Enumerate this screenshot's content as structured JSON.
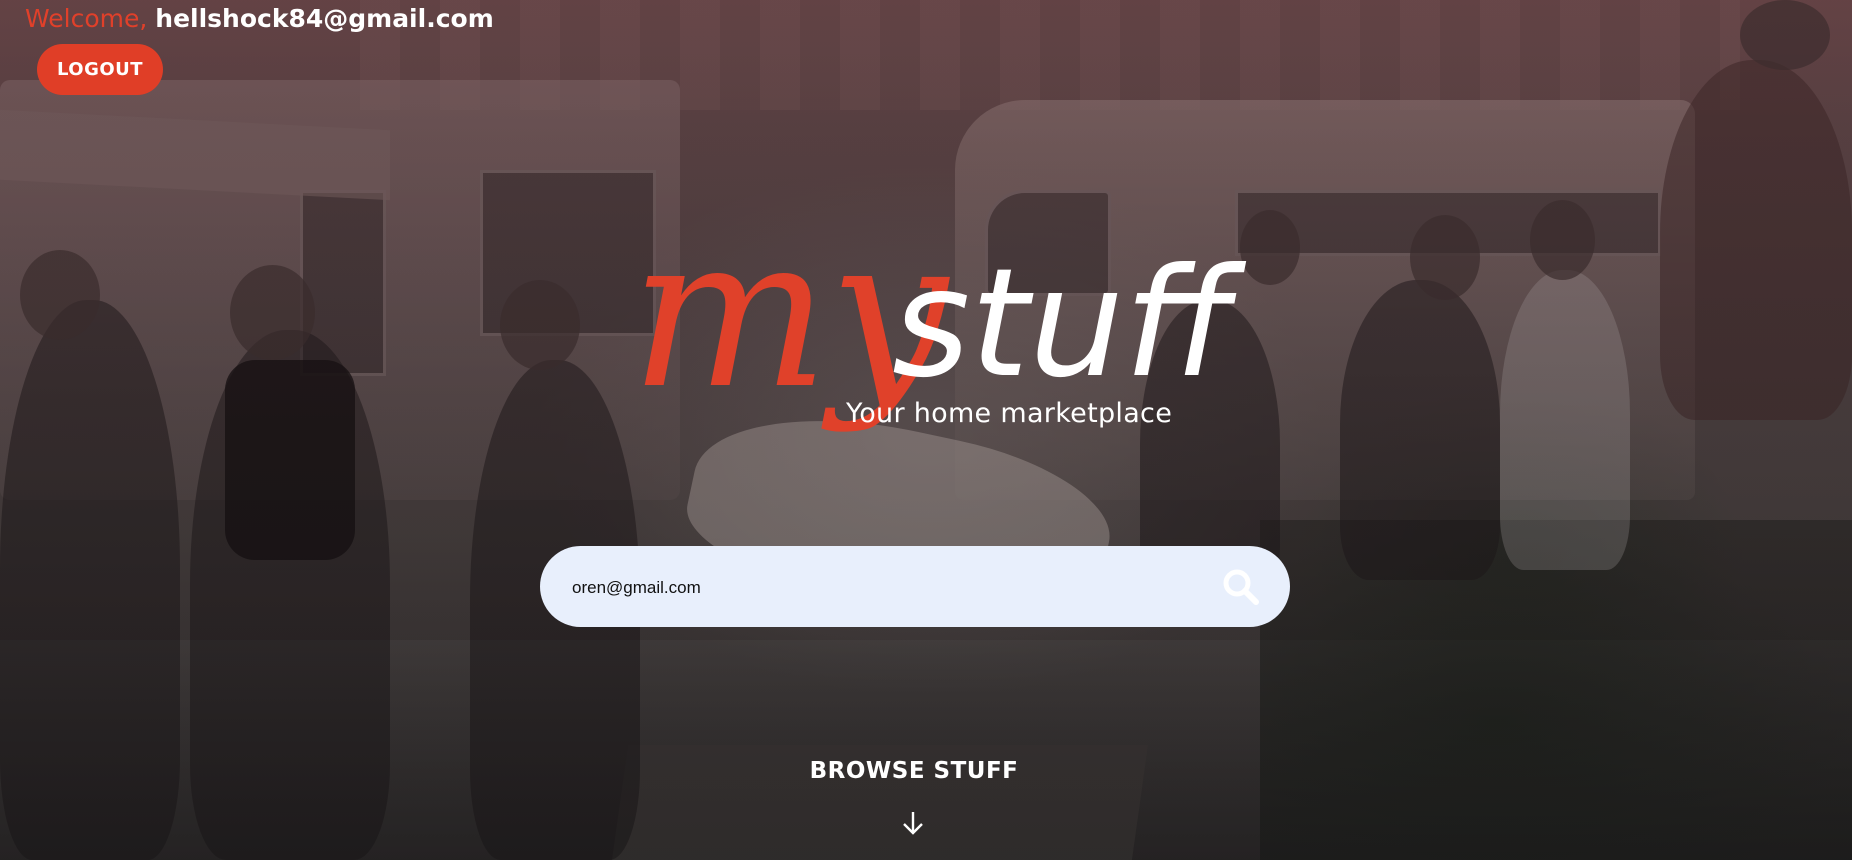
{
  "header": {
    "welcome_label": "Welcome,",
    "user_email": "hellshock84@gmail.com",
    "logout_label": "LOGOUT"
  },
  "logo": {
    "part1": "my",
    "part2": "stuff",
    "tagline": "Your home marketplace"
  },
  "search": {
    "value": "oren@gmail.com",
    "icon": "search-icon"
  },
  "browse": {
    "label": "BROWSE STUFF",
    "icon": "arrow-down-icon"
  },
  "colors": {
    "accent": "#e0402a",
    "search_bg": "#e8effc",
    "text_light": "#ffffff"
  }
}
